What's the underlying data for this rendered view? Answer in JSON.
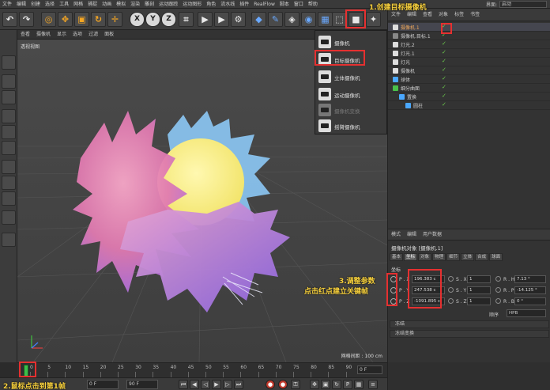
{
  "menubar": {
    "items": [
      "文件",
      "编辑",
      "创建",
      "选择",
      "工具",
      "网格",
      "捕捉",
      "动画",
      "模拟",
      "渲染",
      "雕刻",
      "运动跟踪",
      "运动图形",
      "角色",
      "流水线",
      "插件",
      "RealFlow",
      "脚本",
      "窗口",
      "帮助"
    ],
    "layout_label": "界面:",
    "layout_value": "启动"
  },
  "viewport": {
    "menu": [
      "查看",
      "摄像机",
      "显示",
      "选项",
      "过滤",
      "面板"
    ],
    "label": "透视视图",
    "grid_info": "网格间距 : 100 cm"
  },
  "camera_menu": {
    "items": [
      {
        "label": "摄像机",
        "disabled": false
      },
      {
        "label": "目标摄像机",
        "disabled": false
      },
      {
        "label": "立体摄像机",
        "disabled": false
      },
      {
        "label": "运动摄像机",
        "disabled": false
      },
      {
        "label": "摄像机变换",
        "disabled": true
      },
      {
        "label": "摇臂摄像机",
        "disabled": false
      }
    ]
  },
  "object_manager": {
    "menu": [
      "文件",
      "编辑",
      "查看",
      "对象",
      "标签",
      "书签"
    ],
    "rows": [
      {
        "name": "摄像机.1",
        "indent": 0,
        "selected": true,
        "color": "#dddddd"
      },
      {
        "name": "摄像机.目标.1",
        "indent": 0,
        "selected": false,
        "color": "#888888"
      },
      {
        "name": "灯光.2",
        "indent": 0,
        "selected": false,
        "color": "#dddddd"
      },
      {
        "name": "灯光.1",
        "indent": 0,
        "selected": false,
        "color": "#dddddd"
      },
      {
        "name": "灯光",
        "indent": 0,
        "selected": false,
        "color": "#dddddd"
      },
      {
        "name": "摄像机",
        "indent": 0,
        "selected": false,
        "color": "#dddddd"
      },
      {
        "name": "球体",
        "indent": 0,
        "selected": false,
        "color": "#4aa8ff"
      },
      {
        "name": "细分曲面",
        "indent": 0,
        "selected": false,
        "color": "#4ac04a"
      },
      {
        "name": "置换",
        "indent": 1,
        "selected": false,
        "color": "#4aa8ff"
      },
      {
        "name": "圆柱",
        "indent": 2,
        "selected": false,
        "color": "#4aa8ff"
      }
    ]
  },
  "attributes": {
    "menu": [
      "模式",
      "编辑",
      "用户数据"
    ],
    "title": "摄像机对象 [摄像机.1]",
    "tabs": [
      "基本",
      "坐标",
      "对象",
      "物理",
      "细节",
      "立体",
      "合成",
      "球面"
    ],
    "active_tab": "坐标",
    "section_label": "坐标",
    "position": {
      "x_label": "P . X",
      "x": "196.383 c",
      "y_label": "P . Y",
      "y": "247.538 c",
      "z_label": "P . Z",
      "z": "-1091.895 c"
    },
    "scale": {
      "x_label": "S . X",
      "x": "1",
      "y_label": "S . Y",
      "y": "1",
      "z_label": "S . Z",
      "z": "1"
    },
    "rotation": {
      "h_label": "R . H",
      "h": "7.13 °",
      "p_label": "R . P",
      "p": "-14.125 °",
      "b_label": "R . B",
      "b": "0 °"
    },
    "order_label": "顺序",
    "order_value": "HPB",
    "sections": [
      "冻结",
      "冻结变换"
    ]
  },
  "timeline": {
    "ticks": [
      "0",
      "5",
      "10",
      "15",
      "20",
      "25",
      "30",
      "35",
      "40",
      "45",
      "50",
      "55",
      "60",
      "65",
      "70",
      "75",
      "80",
      "85",
      "90"
    ],
    "current_frame": "0 F"
  },
  "playbar": {
    "start": "0 F",
    "end": "90 F"
  },
  "annotations": {
    "step1": "1.创建目标摄像机",
    "step2": "2.鼠标点击到第1帧",
    "step3_line1": "3.调整参数",
    "step3_line2": "点击红点建立关键帧"
  }
}
